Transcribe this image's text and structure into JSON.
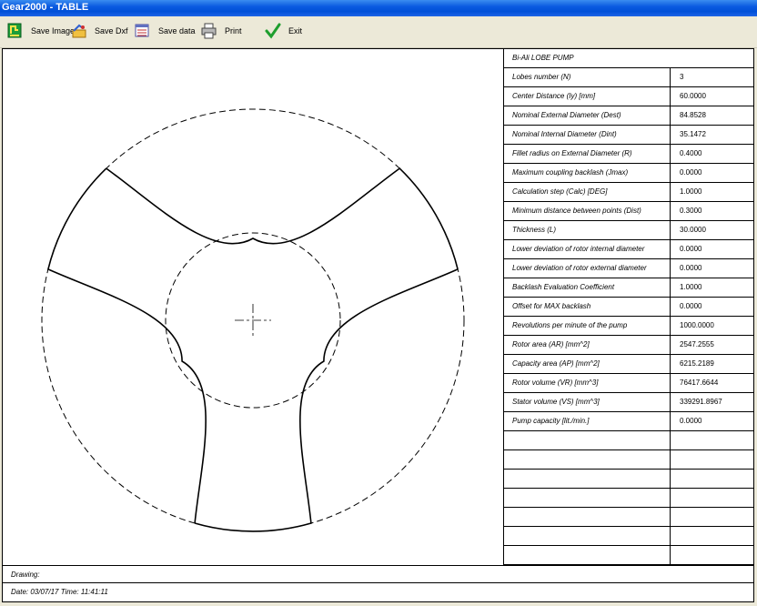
{
  "window": {
    "title": "Gear2000 - TABLE"
  },
  "toolbar": {
    "buttons": [
      {
        "label": "Save Image",
        "icon": "save-image-icon"
      },
      {
        "label": "Save Dxf",
        "icon": "save-dxf-icon"
      },
      {
        "label": "Save data",
        "icon": "save-data-icon"
      },
      {
        "label": "Print",
        "icon": "print-icon"
      },
      {
        "label": "Exit",
        "icon": "checkmark-icon"
      }
    ]
  },
  "table": {
    "header": "Bi-Ali LOBE PUMP",
    "rows": [
      {
        "label": "Lobes number (N)",
        "value": "3"
      },
      {
        "label": "Center Distance (Iy) [mm]",
        "value": "60.0000"
      },
      {
        "label": "Nominal External Diameter (Dest)",
        "value": "84.8528"
      },
      {
        "label": "Nominal Internal Diameter (Dint)",
        "value": "35.1472"
      },
      {
        "label": "Fillet radius on External Diameter (R)",
        "value": "0.4000"
      },
      {
        "label": "Maximum coupling backlash (Jmax)",
        "value": "0.0000"
      },
      {
        "label": "Calculation step       (Calc) [DEG]",
        "value": "1.0000"
      },
      {
        "label": "Minimum distance between points (Dist)",
        "value": "0.3000"
      },
      {
        "label": "Thickness (L)",
        "value": "30.0000"
      },
      {
        "label": "Lower deviation of rotor internal diameter",
        "value": "0.0000"
      },
      {
        "label": "Lower deviation of rotor external diameter",
        "value": "0.0000"
      },
      {
        "label": "Backlash Evaluation Coefficient",
        "value": "1.0000"
      },
      {
        "label": "Offset for MAX backlash",
        "value": "0.0000"
      },
      {
        "label": "Revolutions per minute of the pump",
        "value": "1000.0000"
      },
      {
        "label": "Rotor area   (AR) [mm^2]",
        "value": "2547.2555"
      },
      {
        "label": "Capacity area      (AP) [mm^2]",
        "value": "6215.2189"
      },
      {
        "label": "Rotor volume (VR) [mm^3]",
        "value": "76417.6644"
      },
      {
        "label": "Stator volume (VS) [mm^3]",
        "value": "339291.8967"
      },
      {
        "label": "Pump capacity [lit./min.]",
        "value": "0.0000"
      },
      {
        "label": "",
        "value": ""
      },
      {
        "label": "",
        "value": ""
      },
      {
        "label": "",
        "value": ""
      },
      {
        "label": "",
        "value": ""
      },
      {
        "label": "",
        "value": ""
      },
      {
        "label": "",
        "value": ""
      },
      {
        "label": "",
        "value": ""
      }
    ]
  },
  "footer": {
    "drawing_label": "Drawing:",
    "date_text": "Date: 03/07/17 Time: 11:41:11"
  }
}
